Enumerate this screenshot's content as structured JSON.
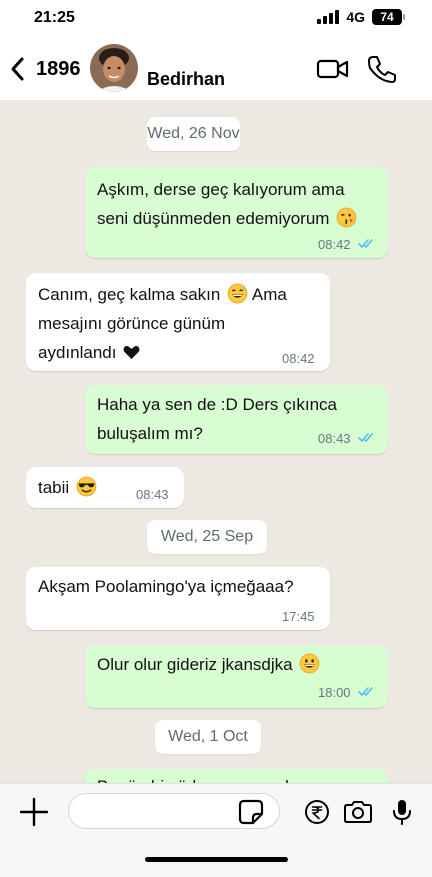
{
  "status_bar": {
    "time": "21:25",
    "network": "4G",
    "battery": "74"
  },
  "header": {
    "unread_count": "1896",
    "contact_name": "Bedirhan"
  },
  "dates": [
    "Wed, 26 Nov",
    "Wed, 25 Sep",
    "Wed, 1 Oct"
  ],
  "messages": [
    {
      "direction": "outgoing",
      "lines": [
        "Aşkım, derse geç kalıyorum ama",
        "seni düşünmeden edemiyorum"
      ],
      "emoji": "kissing-wink",
      "time": "08:42",
      "read": true
    },
    {
      "direction": "incoming",
      "lines": [
        "Canım, geç kalma sakın",
        "Ama",
        "mesajını görünce günüm",
        "aydınlandı"
      ],
      "emoji": "grinning-sweat",
      "time": "08:42"
    },
    {
      "direction": "outgoing",
      "lines": [
        "Haha ya sen de :D Ders çıkınca",
        "buluşalım mı?"
      ],
      "time": "08:43",
      "read": true
    },
    {
      "direction": "incoming",
      "lines": [
        "tabii"
      ],
      "emoji": "sunglasses",
      "time": "08:43"
    },
    {
      "direction": "incoming",
      "lines": [
        "Akşam Poolamingo'ya içmeğaaa?"
      ],
      "time": "17:45"
    },
    {
      "direction": "outgoing",
      "lines": [
        "Olur olur gideriz jkansdjka"
      ],
      "emoji": "grinning",
      "time": "18:00",
      "read": true
    },
    {
      "direction": "outgoing",
      "lines": [
        "Bugün hiç ödev yapamadım, sen"
      ],
      "partial": true
    }
  ],
  "composer": {
    "value": "",
    "placeholder": ""
  },
  "colors": {
    "outgoing_bubble": "#d9fdd3",
    "incoming_bubble": "#ffffff",
    "read_ticks": "#53bdeb",
    "background": "#ede8e1"
  },
  "icons": [
    "back-chevron-icon",
    "video-call-icon",
    "phone-call-icon",
    "plus-icon",
    "sticker-icon",
    "rupee-payment-icon",
    "camera-icon",
    "microphone-icon"
  ]
}
